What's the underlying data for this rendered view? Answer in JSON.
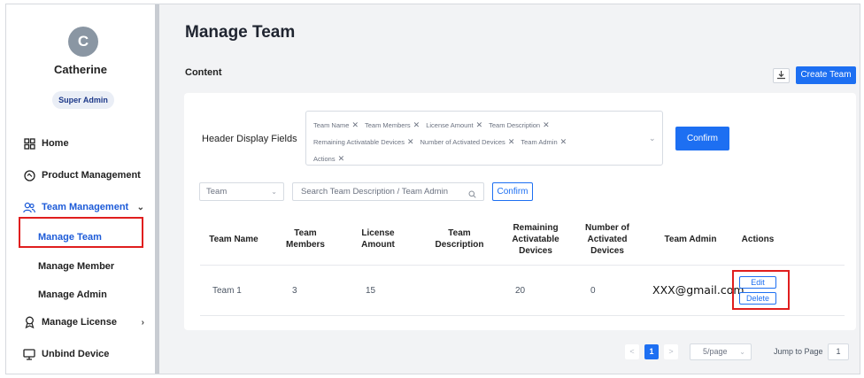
{
  "user": {
    "initial": "C",
    "name": "Catherine",
    "role": "Super Admin"
  },
  "sidebar": {
    "home": "Home",
    "product_management": "Product Management",
    "team_management": "Team Management",
    "sub_items": [
      "Manage Team",
      "Manage Member",
      "Manage Admin"
    ],
    "manage_license": "Manage License",
    "unbind_device": "Unbind Device"
  },
  "page": {
    "title": "Manage Team",
    "section": "Content",
    "create_button": "Create Team"
  },
  "filters": {
    "header_display_label": "Header Display Fields",
    "tags": [
      "Team Name",
      "Team Members",
      "License Amount",
      "Team Description",
      "Remaining Activatable Devices",
      "Number of Activated Devices",
      "Team Admin",
      "Actions"
    ],
    "confirm_label": "Confirm",
    "team_select": "Team",
    "search_placeholder": "Search Team Description / Team Admin",
    "search_confirm": "Confirm"
  },
  "table": {
    "headers": [
      "Team Name",
      "Team Members",
      "License Amount",
      "Team Description",
      "Remaining Activatable Devices",
      "Number of Activated Devices",
      "Team Admin",
      "Actions"
    ],
    "rows": [
      {
        "team_name": "Team 1",
        "team_members": "3",
        "license_amount": "15",
        "team_description": "",
        "remaining": "20",
        "activated": "0",
        "team_admin": "XXX@gmail.com"
      }
    ],
    "actions": {
      "edit": "Edit",
      "delete": "Delete"
    }
  },
  "pagination": {
    "prev": "<",
    "current_page": "1",
    "next": ">",
    "page_size": "5/page",
    "jump_label": "Jump to Page",
    "jump_value": "1"
  },
  "colors": {
    "primary": "#1d6ff2",
    "highlight": "#e01e1e"
  },
  "icons": [
    "home-icon",
    "product-icon",
    "team-icon",
    "license-icon",
    "monitor-icon",
    "download-icon",
    "search-icon",
    "close-icon",
    "chevron-down-icon",
    "chevron-right-icon"
  ]
}
